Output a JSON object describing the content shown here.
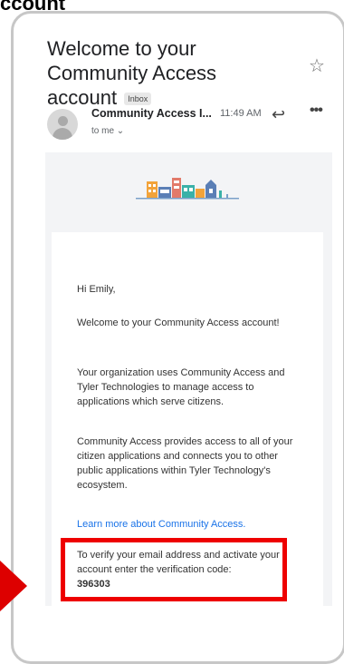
{
  "page_top_text": "ccount",
  "email": {
    "subject": "Welcome to your Community Access account",
    "label_chip": "Inbox",
    "sender": "Community Access I...",
    "time": "11:49 AM",
    "recipient": "to me",
    "icons": [
      "star-icon",
      "reply-icon",
      "more-icon",
      "chevron-down-icon",
      "avatar-icon",
      "buildings-logo"
    ]
  },
  "body": {
    "greeting": "Hi Emily,",
    "welcome": "Welcome to your Community Access account!",
    "organization": "Your organization uses Community Access and Tyler Technologies to manage access to applications which serve citizens.",
    "provides": "Community Access provides access to all of your citizen applications and connects you to other public applications within Tyler Technology's ecosystem.",
    "learn_more_link": "Learn more about Community Access.",
    "verify_text": "To verify your email address and activate your account enter the verification code:",
    "verification_code": "396303"
  },
  "colors": {
    "highlight": "#ee0000",
    "link": "#1a73e8"
  }
}
